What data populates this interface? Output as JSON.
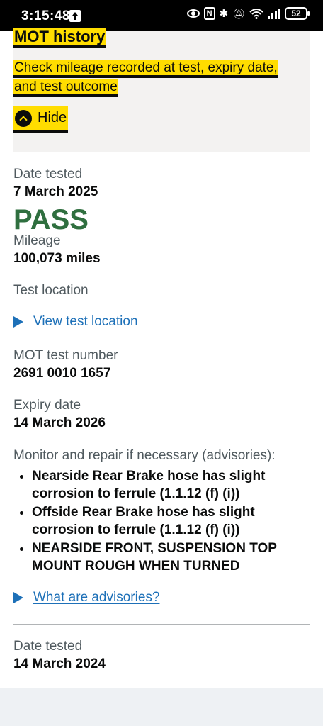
{
  "status_bar": {
    "time": "3:15:48",
    "battery": "52"
  },
  "mot_panel": {
    "title": "MOT history",
    "description": "Check mileage recorded at test, expiry date, and test outcome",
    "toggle_label": "Hide"
  },
  "test_2025": {
    "date_label": "Date tested",
    "date": "7 March 2025",
    "result": "PASS",
    "mileage_label": "Mileage",
    "mileage": "100,073 miles",
    "location_label": "Test location",
    "location_link": "View test location",
    "number_label": "MOT test number",
    "number": "2691 0010 1657",
    "expiry_label": "Expiry date",
    "expiry": "14 March 2026",
    "advisories_label": "Monitor and repair if necessary (advisories):",
    "advisories": [
      "Nearside Rear Brake hose has slight corrosion to ferrule (1.1.12 (f) (i))",
      "Offside Rear Brake hose has slight corrosion to ferrule (1.1.12 (f) (i))",
      "NEARSIDE FRONT, SUSPENSION TOP MOUNT ROUGH WHEN TURNED"
    ],
    "advisories_link": "What are advisories?"
  },
  "test_2024": {
    "date_label": "Date tested",
    "date": "14 March 2024"
  },
  "colors": {
    "pass_green": "#2f6f3f",
    "link_blue": "#1d70b8",
    "focus_yellow": "#ffdd00",
    "panel_grey": "#f3f2f1"
  }
}
